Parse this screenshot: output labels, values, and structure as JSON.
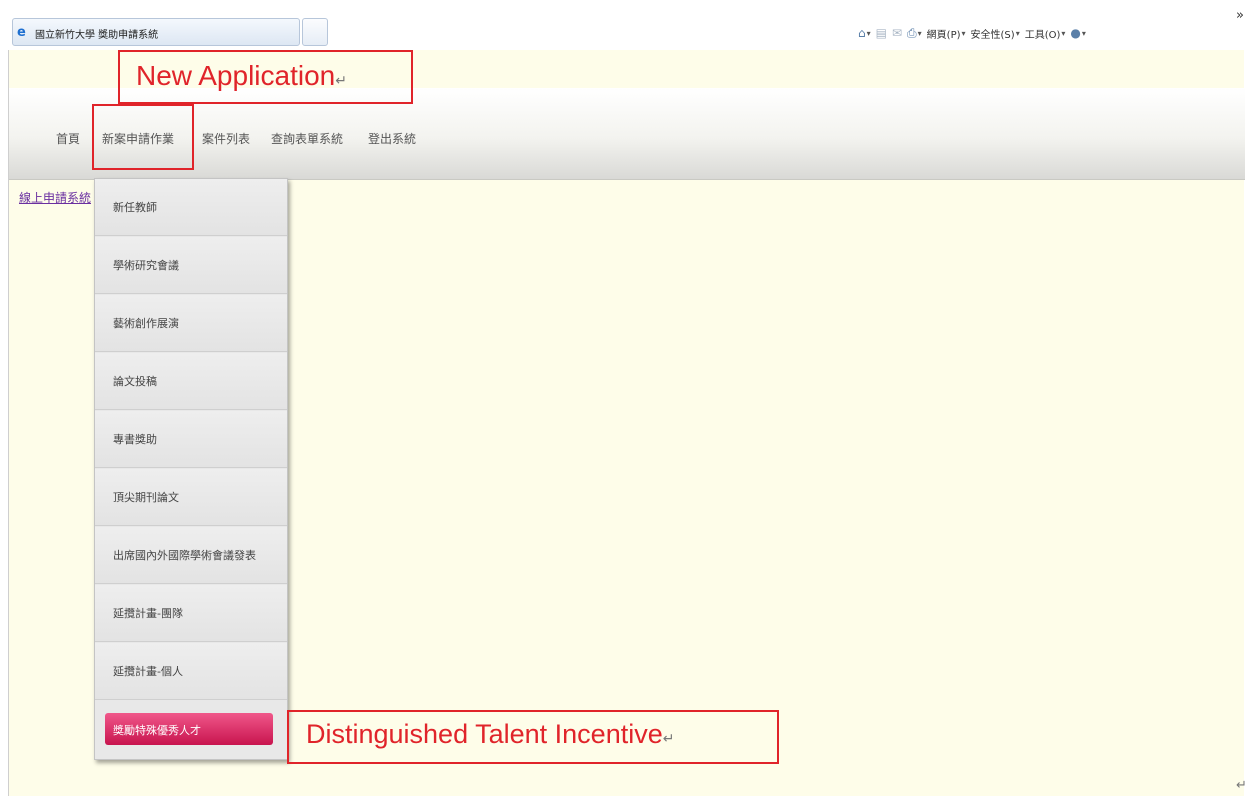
{
  "browser": {
    "tab_title": "國立新竹大學 獎助申請系統",
    "command_bar": [
      {
        "icon": "home-icon",
        "label": ""
      },
      {
        "icon": "rss-feed-icon",
        "label": ""
      },
      {
        "icon": "mail-icon",
        "label": ""
      },
      {
        "icon": "print-icon",
        "label": ""
      },
      {
        "icon": "page-menu-icon",
        "label": "網頁(P)"
      },
      {
        "icon": "safety-menu-icon",
        "label": "安全性(S)"
      },
      {
        "icon": "tools-menu-icon",
        "label": "工具(O)"
      },
      {
        "icon": "help-icon",
        "label": ""
      }
    ],
    "overflow_chevron": "»"
  },
  "nav": {
    "items": [
      "首頁",
      "新案申請作業",
      "案件列表",
      "查詢表單系統",
      "登出系統"
    ]
  },
  "side_link": "線上申請系統",
  "dropdown": {
    "items": [
      "新任教師",
      "學術研究會議",
      "藝術創作展演",
      "論文投稿",
      "專書獎助",
      "頂尖期刊論文",
      "出席國內外國際學術會議發表",
      "延攬計畫-團隊",
      "延攬計畫-個人",
      "獎勵特殊優秀人才"
    ],
    "highlighted_index": 9
  },
  "annotations": {
    "new_application": "New Application",
    "talent_incentive": "Distinguished Talent Incentive",
    "return_mark": "↵"
  },
  "colors": {
    "annotation_red": "#e0242a",
    "highlight_pink": "#d91b5c",
    "page_background": "#fefde9"
  }
}
